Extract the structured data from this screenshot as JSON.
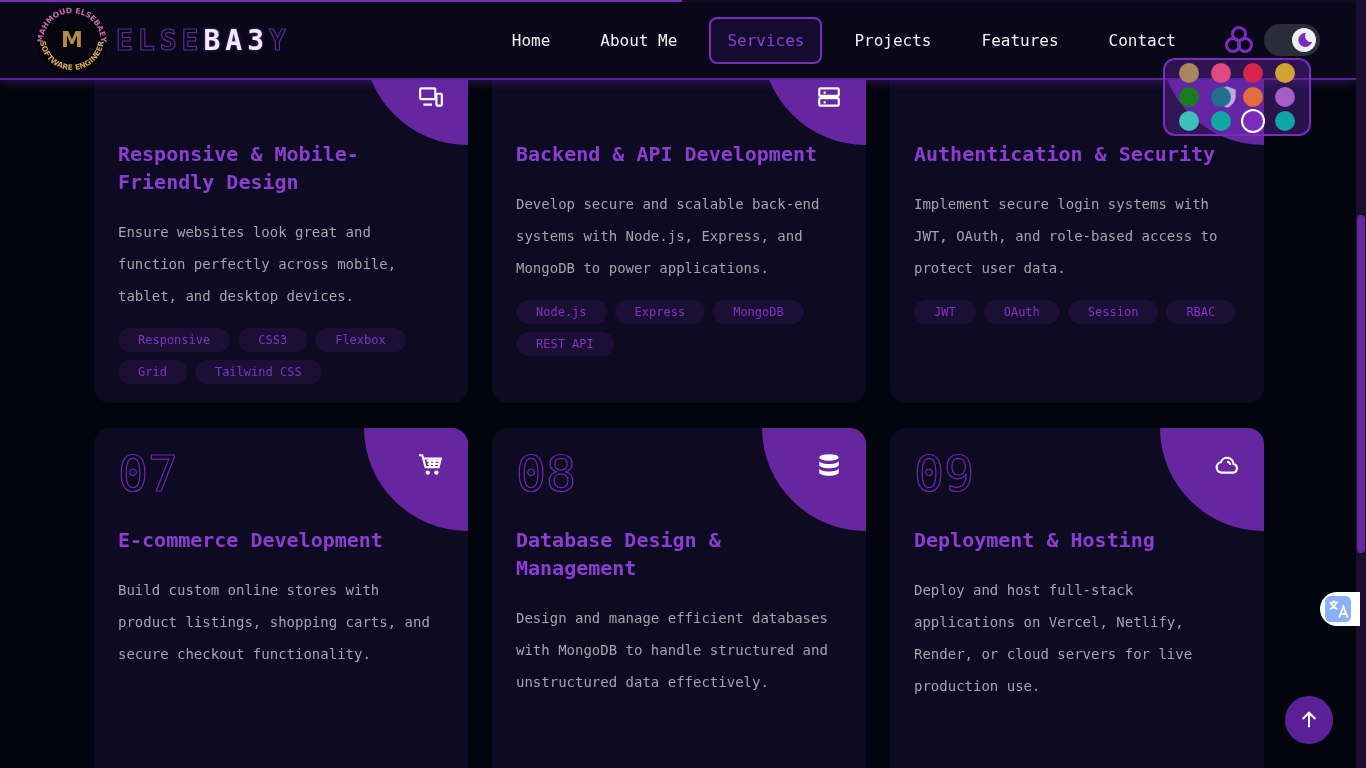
{
  "scroll_progress": {
    "level": 0.503
  },
  "header": {
    "logo": {
      "monogram": "M",
      "ring_top": "MAHMOUD ELSEBAEY",
      "ring_bottom": "SOFTWARE ENGINEER"
    },
    "brand": [
      {
        "text": "ELSE",
        "kind": "outline"
      },
      {
        "text": "BA3",
        "kind": "filled"
      },
      {
        "text": "Y",
        "kind": "outline"
      }
    ],
    "nav": [
      {
        "label": "Home",
        "selected": false
      },
      {
        "label": "About Me",
        "selected": false
      },
      {
        "label": "Services",
        "selected": true
      },
      {
        "label": "Projects",
        "selected": false
      },
      {
        "label": "Features",
        "selected": false
      },
      {
        "label": "Contact",
        "selected": false
      }
    ],
    "dark_mode": {
      "on": true
    }
  },
  "color_palette": [
    {
      "color": "#a8875e",
      "selected": false
    },
    {
      "color": "#df4b7e",
      "selected": false
    },
    {
      "color": "#d8234f",
      "selected": false
    },
    {
      "color": "#d2a232",
      "selected": false
    },
    {
      "color": "#197c20",
      "selected": false
    },
    {
      "color": "#21708f",
      "selected": false
    },
    {
      "color": "#e26c3c",
      "selected": false
    },
    {
      "color": "#a35fc6",
      "selected": false
    },
    {
      "color": "#3cc0bb",
      "selected": false
    },
    {
      "color": "#11a7a6",
      "selected": false
    },
    {
      "color": "#7b2cbf",
      "selected": true
    },
    {
      "color": "#0fa5a8",
      "selected": false
    }
  ],
  "services": [
    {
      "title": "Responsive & Mobile-Friendly Design",
      "description": "Ensure websites look great and function perfectly across mobile, tablet, and desktop devices.",
      "tags": [
        "Responsive",
        "CSS3",
        "Flexbox",
        "Grid",
        "Tailwind CSS"
      ]
    },
    {
      "title": "Backend & API Development",
      "description": "Develop secure and scalable back-end systems with Node.js, Express, and MongoDB to power applications.",
      "tags": [
        "Node.js",
        "Express",
        "MongoDB",
        "REST API"
      ]
    },
    {
      "title": "Authentication & Security",
      "description": "Implement secure login systems with JWT, OAuth, and role-based access to protect user data.",
      "tags": [
        "JWT",
        "OAuth",
        "Session",
        "RBAC"
      ]
    },
    {
      "number": "07",
      "title": "E-commerce Development",
      "description": "Build custom online stores with product listings, shopping carts, and secure checkout functionality."
    },
    {
      "number": "08",
      "title": "Database Design & Management",
      "description": "Design and manage efficient databases with MongoDB to handle structured and unstructured data effectively."
    },
    {
      "number": "09",
      "title": "Deployment & Hosting",
      "description": "Deploy and host full-stack applications on Vercel, Netlify, Render, or cloud servers for live production use."
    }
  ]
}
